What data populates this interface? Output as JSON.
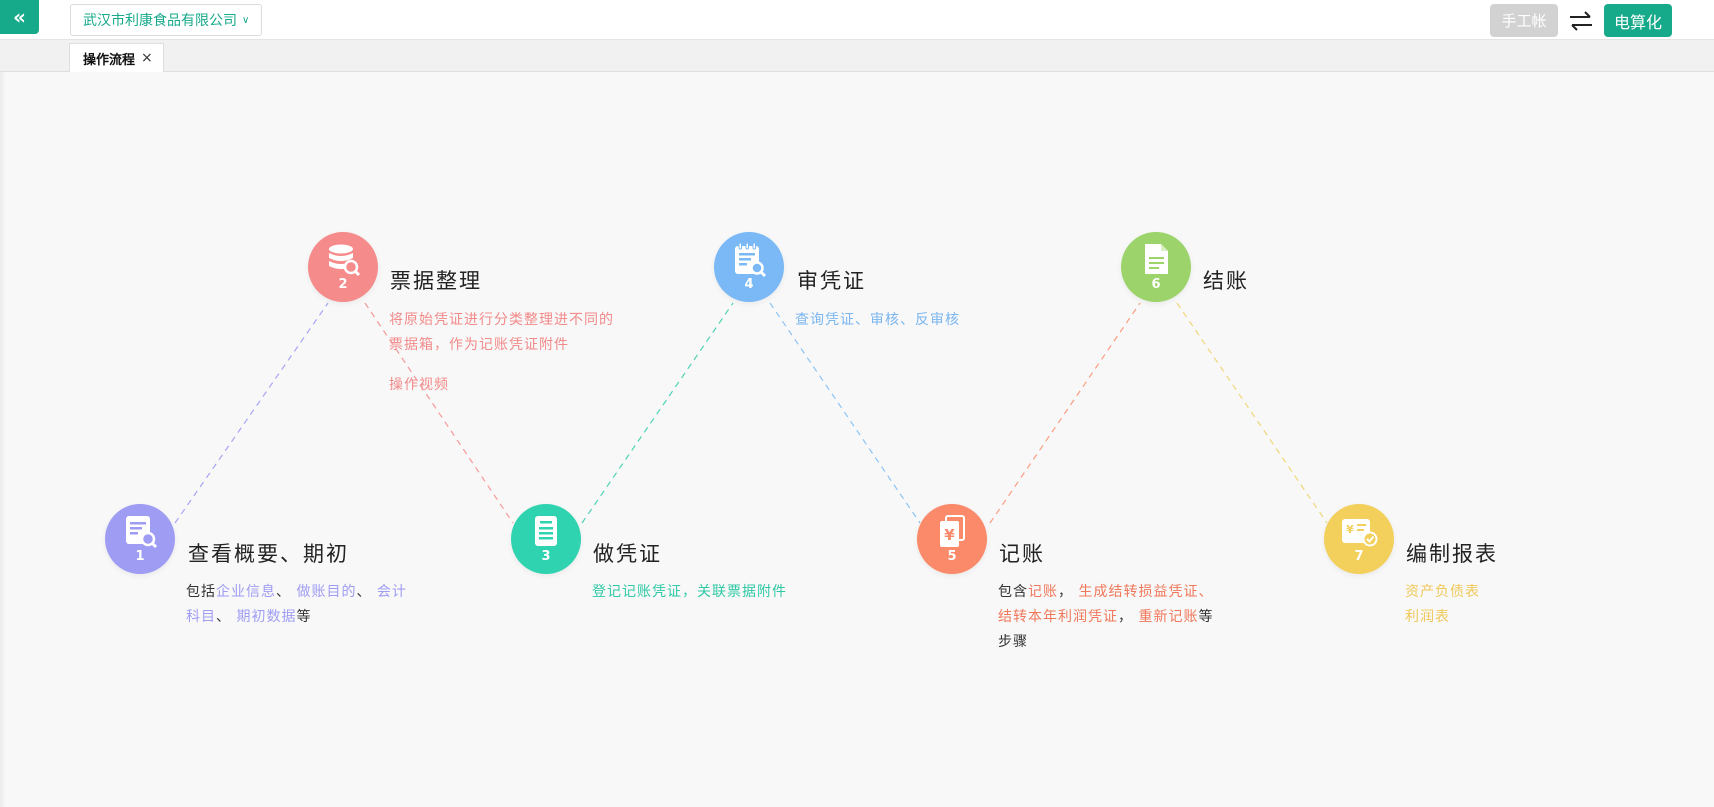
{
  "header": {
    "collapse_icon": "double-chevron-left-icon",
    "company": "武汉市利康食品有限公司",
    "manual_button": "手工帐",
    "swap_icon": "swap-arrows-icon",
    "compute_button": "电算化"
  },
  "tabs": [
    {
      "label": "操作流程",
      "close": "×"
    }
  ],
  "steps": [
    {
      "num": "1",
      "title": "查看概要、期初",
      "color": "#9f9df3",
      "icon": "document-search-icon",
      "desc": {
        "prefix": "包括",
        "l1": "企业信息",
        "s1": "、 ",
        "l2": "做账目的",
        "s2": "、 ",
        "l3": "会计科目",
        "s3": "、 ",
        "l4": "期初数据",
        "suffix": "等"
      }
    },
    {
      "num": "2",
      "title": "票据整理",
      "color": "#f68b8b",
      "icon": "database-search-icon",
      "desc": {
        "text": "将原始凭证进行分类整理进不同的票据箱，作为记账凭证附件",
        "video": "操作视频"
      }
    },
    {
      "num": "3",
      "title": "做凭证",
      "color": "#2fd3b0",
      "icon": "voucher-doc-icon",
      "desc": {
        "text": "登记记账凭证，关联票据附件"
      }
    },
    {
      "num": "4",
      "title": "审凭证",
      "color": "#7ab9f6",
      "icon": "clipboard-search-icon",
      "desc": {
        "text": "查询凭证、审核、反审核"
      }
    },
    {
      "num": "5",
      "title": "记账",
      "color": "#fb8a6a",
      "icon": "yen-docs-icon",
      "desc": {
        "prefix": "包含",
        "l1": "记账",
        "s1": "， ",
        "l2": "生成结转损益凭证、结转本年利润凭证",
        "s2": "， ",
        "l3": "重新记账",
        "suffix": "等步骤"
      }
    },
    {
      "num": "6",
      "title": "结账",
      "color": "#9dd36b",
      "icon": "file-lines-icon",
      "desc": {}
    },
    {
      "num": "7",
      "title": "编制报表",
      "color": "#f3cf5c",
      "icon": "yen-report-check-icon",
      "desc": {
        "l1": "资产负债表",
        "l2": "利润表"
      }
    }
  ]
}
